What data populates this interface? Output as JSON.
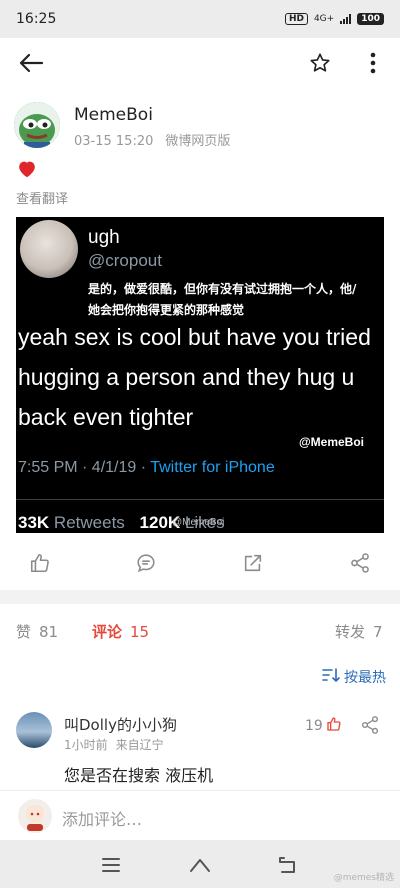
{
  "status_bar": {
    "time": "16:25",
    "hd_badge": "HD",
    "network": "4G+",
    "battery": "100"
  },
  "nav": {
    "back_icon": "arrow-left-icon",
    "favorite_icon": "star-outline-icon",
    "more_icon": "more-vertical-icon"
  },
  "post": {
    "author": "MemeBoi",
    "date": "03-15 15:20",
    "source": "微博网页版",
    "text_emoji": "red-heart-emoji",
    "translate_label": "查看翻译",
    "image": {
      "tweet_name": "ugh",
      "tweet_handle": "@cropout",
      "chinese_caption": "是的，做爱很酷，但你有没有试过拥抱一个人，他/她会把你抱得更紧的那种感觉",
      "english_text": "yeah sex is cool but have you tried hugging a person and they hug u back even tighter",
      "watermark": "@MemeBoi",
      "tweet_time": "7:55 PM · 4/1/19 ·",
      "tweet_app": "Twitter for iPhone",
      "retweets_count": "33K",
      "retweets_label": "Retweets",
      "likes_count": "120K",
      "likes_label": "Likes",
      "watermark_small": "@MemeBoi"
    }
  },
  "actions": [
    {
      "name": "like-action",
      "icon": "thumb-up-icon"
    },
    {
      "name": "comment-action",
      "icon": "comment-icon"
    },
    {
      "name": "repost-action",
      "icon": "repost-icon"
    },
    {
      "name": "share-action",
      "icon": "share-icon"
    }
  ],
  "stats": {
    "likes_label": "赞",
    "likes_count": "81",
    "comments_label": "评论",
    "comments_count": "15",
    "reposts_label": "转发",
    "reposts_count": "7"
  },
  "sort": {
    "label": "按最热",
    "icon": "sort-icon"
  },
  "comments": [
    {
      "author": "叫Dolly的小小狗",
      "time": "1小时前",
      "location": "来自辽宁",
      "like_count": "19",
      "text": "您是否在搜索 液压机"
    }
  ],
  "compose": {
    "placeholder": "添加评论…"
  },
  "system_nav": {
    "menu_icon": "menu-icon",
    "home_icon": "home-icon",
    "back_icon": "back-icon",
    "watermark": "@memes精选"
  },
  "colors": {
    "accent_red": "#e8483a",
    "link_blue": "#2b6bb8",
    "twitter_blue": "#1da1f2"
  }
}
